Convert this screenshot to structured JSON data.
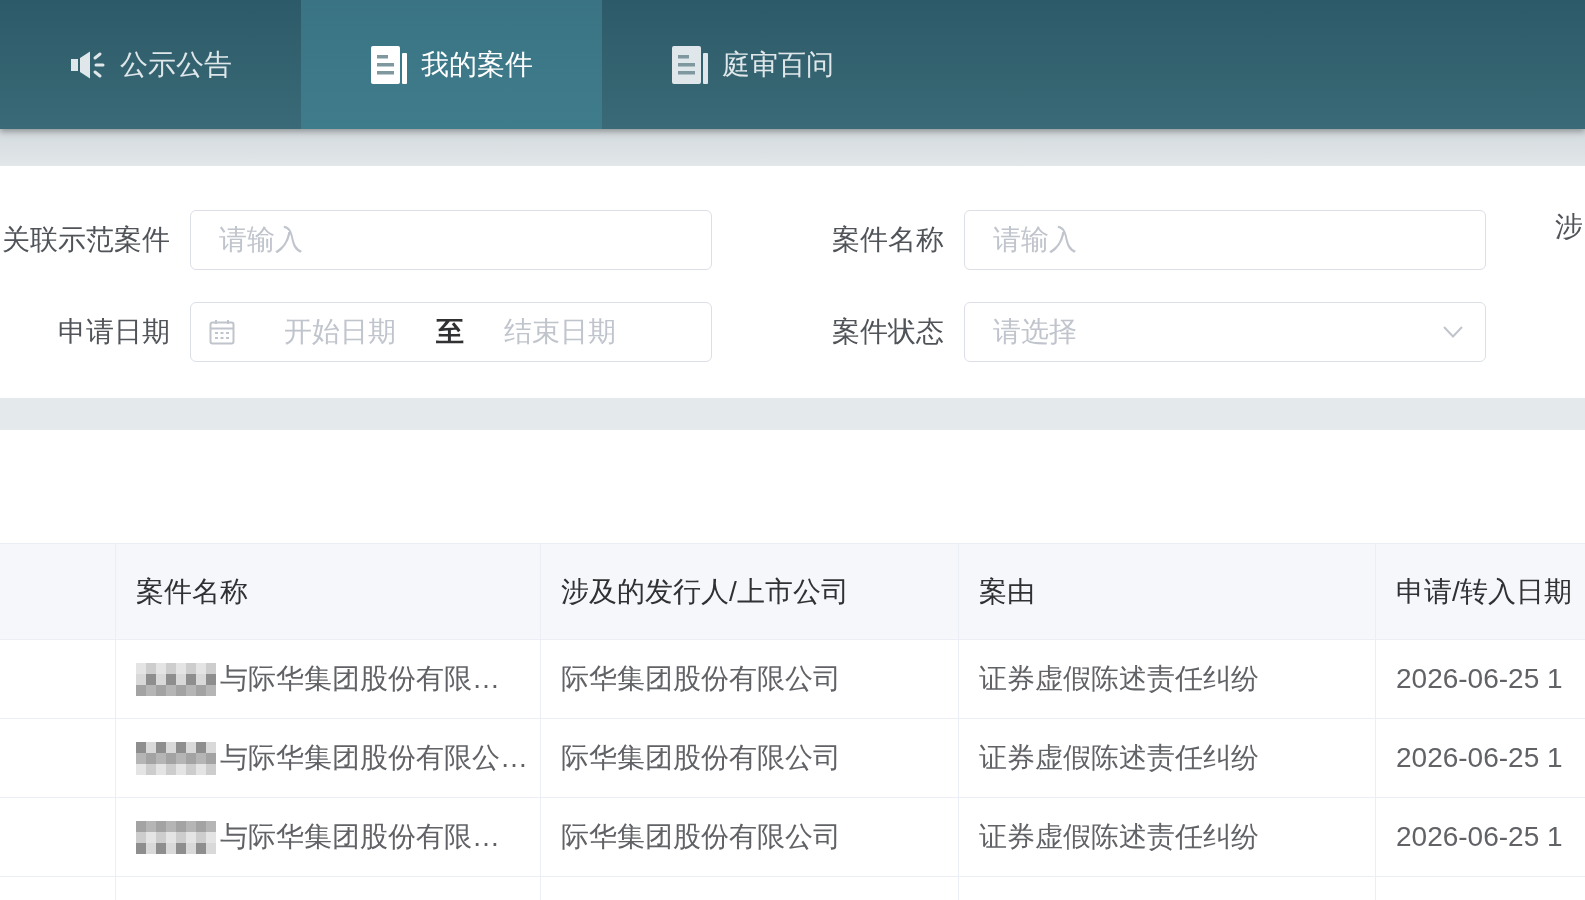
{
  "nav": {
    "tabs": [
      {
        "label": "公示公告",
        "kind": "notice",
        "selected": false
      },
      {
        "label": "我的案件",
        "kind": "document",
        "selected": true
      },
      {
        "label": "庭审百问",
        "kind": "document",
        "selected": false
      }
    ]
  },
  "filters": {
    "rows": [
      [
        {
          "label": "关联示范案件",
          "kind": "text",
          "placeholder": "请输入"
        },
        {
          "label": "案件名称",
          "kind": "text",
          "placeholder": "请输入"
        },
        {
          "label": "涉",
          "kind": "label"
        }
      ],
      [
        {
          "label": "申请日期",
          "kind": "date_range",
          "start_placeholder": "开始日期",
          "separator": "至",
          "end_placeholder": "结束日期"
        },
        {
          "label": "案件状态",
          "kind": "select",
          "placeholder": "请选择"
        }
      ]
    ]
  },
  "table": {
    "columns": [
      "案件名称",
      "涉及的发行人/上市公司",
      "案由",
      "申请/转入日期"
    ],
    "rows": [
      {
        "redacted": true,
        "cells": [
          "与际华集团股份有限…",
          "际华集团股份有限公司",
          "证券虚假陈述责任纠纷",
          "2026-06-25 1"
        ]
      },
      {
        "redacted": true,
        "cells": [
          "与际华集团股份有限公…",
          "际华集团股份有限公司",
          "证券虚假陈述责任纠纷",
          "2026-06-25 1"
        ]
      },
      {
        "redacted": true,
        "cells": [
          "与际华集团股份有限…",
          "际华集团股份有限公司",
          "证券虚假陈述责任纠纷",
          "2026-06-25 1"
        ]
      }
    ]
  }
}
